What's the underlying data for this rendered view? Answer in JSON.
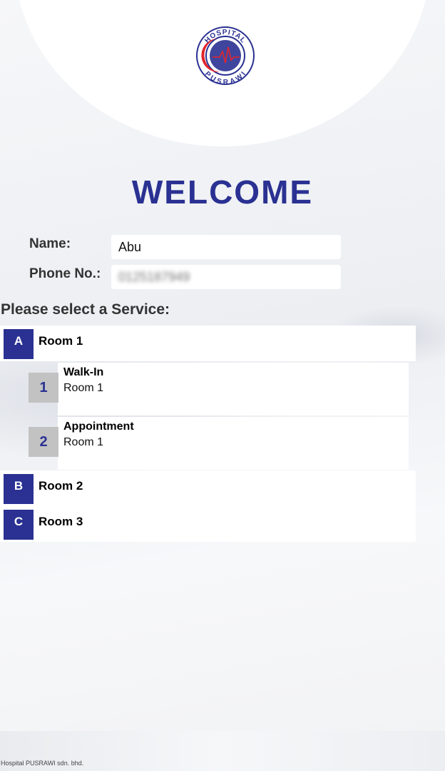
{
  "logo": {
    "text_top": "HOSPITAL",
    "text_bottom": "PUSRAWI",
    "colors": {
      "ring": "#2a3192",
      "crescent": "#e3242b"
    }
  },
  "welcome": "WELCOME",
  "form": {
    "name_label": "Name:",
    "name_value": "Abu",
    "phone_label": "Phone No.:",
    "phone_value": "0125187949"
  },
  "service_prompt": "Please select a Service:",
  "rooms": [
    {
      "letter": "A",
      "name": "Room 1"
    },
    {
      "letter": "B",
      "name": "Room 2"
    },
    {
      "letter": "C",
      "name": "Room 3"
    }
  ],
  "services": [
    {
      "number": "1",
      "title": "Walk-In",
      "room": "Room 1"
    },
    {
      "number": "2",
      "title": "Appointment",
      "room": "Room 1"
    }
  ],
  "footer": "Hospital PUSRAWI sdn. bhd.",
  "colors": {
    "primary": "#2a3192",
    "badge_gray": "#c2c2c2"
  }
}
